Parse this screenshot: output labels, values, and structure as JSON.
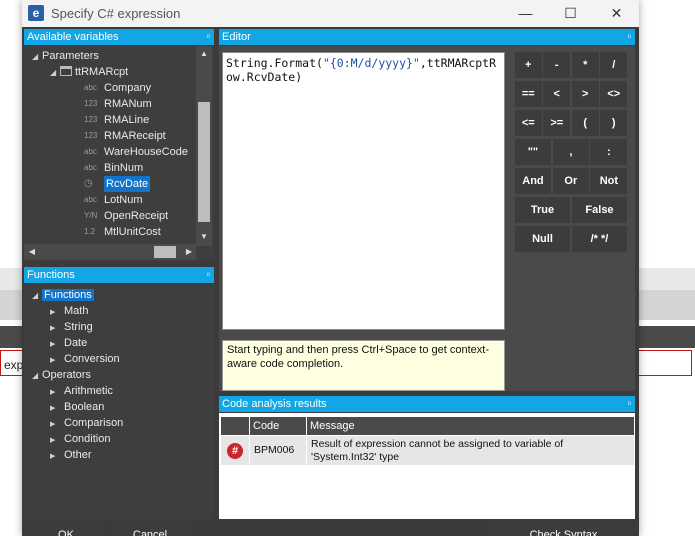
{
  "window": {
    "title": "Specify C# expression",
    "app_icon": "e",
    "minimize": "—",
    "maximize": "☐",
    "close": "✕"
  },
  "background": {
    "input_text": "exp"
  },
  "variables_panel": {
    "title": "Available variables",
    "pin": "ᵒ",
    "parameters_label": "Parameters",
    "table_label": "ttRMARcpt",
    "fields": [
      {
        "type": "abc",
        "name": "Company"
      },
      {
        "type": "123",
        "name": "RMANum"
      },
      {
        "type": "123",
        "name": "RMALine"
      },
      {
        "type": "123",
        "name": "RMAReceipt"
      },
      {
        "type": "abc",
        "name": "WareHouseCode"
      },
      {
        "type": "abc",
        "name": "BinNum"
      },
      {
        "type": "clock",
        "name": "RcvDate"
      },
      {
        "type": "abc",
        "name": "LotNum"
      },
      {
        "type": "Y/N",
        "name": "OpenReceipt"
      },
      {
        "type": "1.2",
        "name": "MtlUnitCost"
      }
    ]
  },
  "functions_panel": {
    "title": "Functions",
    "pin": "ᵒ",
    "root1": "Functions",
    "root1_children": [
      "Math",
      "String",
      "Date",
      "Conversion"
    ],
    "root2": "Operators",
    "root2_children": [
      "Arithmetic",
      "Boolean",
      "Comparison",
      "Condition",
      "Other"
    ]
  },
  "editor": {
    "title": "Editor",
    "pin": "ᵒ",
    "code_prefix": "String.Format(",
    "code_string": "\"{0:M/d/yyyy}\"",
    "code_suffix": ",ttRMARcptRow.RcvDate)",
    "hint": "Start typing and then press Ctrl+Space to get context-aware code completion.",
    "operators": [
      [
        "+",
        "-",
        "*",
        "/"
      ],
      [
        "==",
        "<",
        ">",
        "<>"
      ],
      [
        "<=",
        ">=",
        "(",
        ")"
      ],
      [
        "\"\"",
        ",",
        ":"
      ],
      [
        "And",
        "Or",
        "Not"
      ],
      [
        "True",
        "False"
      ],
      [
        "Null",
        "/* */"
      ]
    ]
  },
  "code_analysis": {
    "title": "Code analysis results",
    "pin": "ᵒ",
    "col_code": "Code",
    "col_message": "Message",
    "rows": [
      {
        "icon": "#",
        "code": "BPM006",
        "message": "Result of expression cannot be assigned to variable of 'System.Int32' type"
      }
    ]
  },
  "buttons": {
    "ok": "OK",
    "cancel": "Cancel",
    "check_syntax": "Check Syntax"
  }
}
